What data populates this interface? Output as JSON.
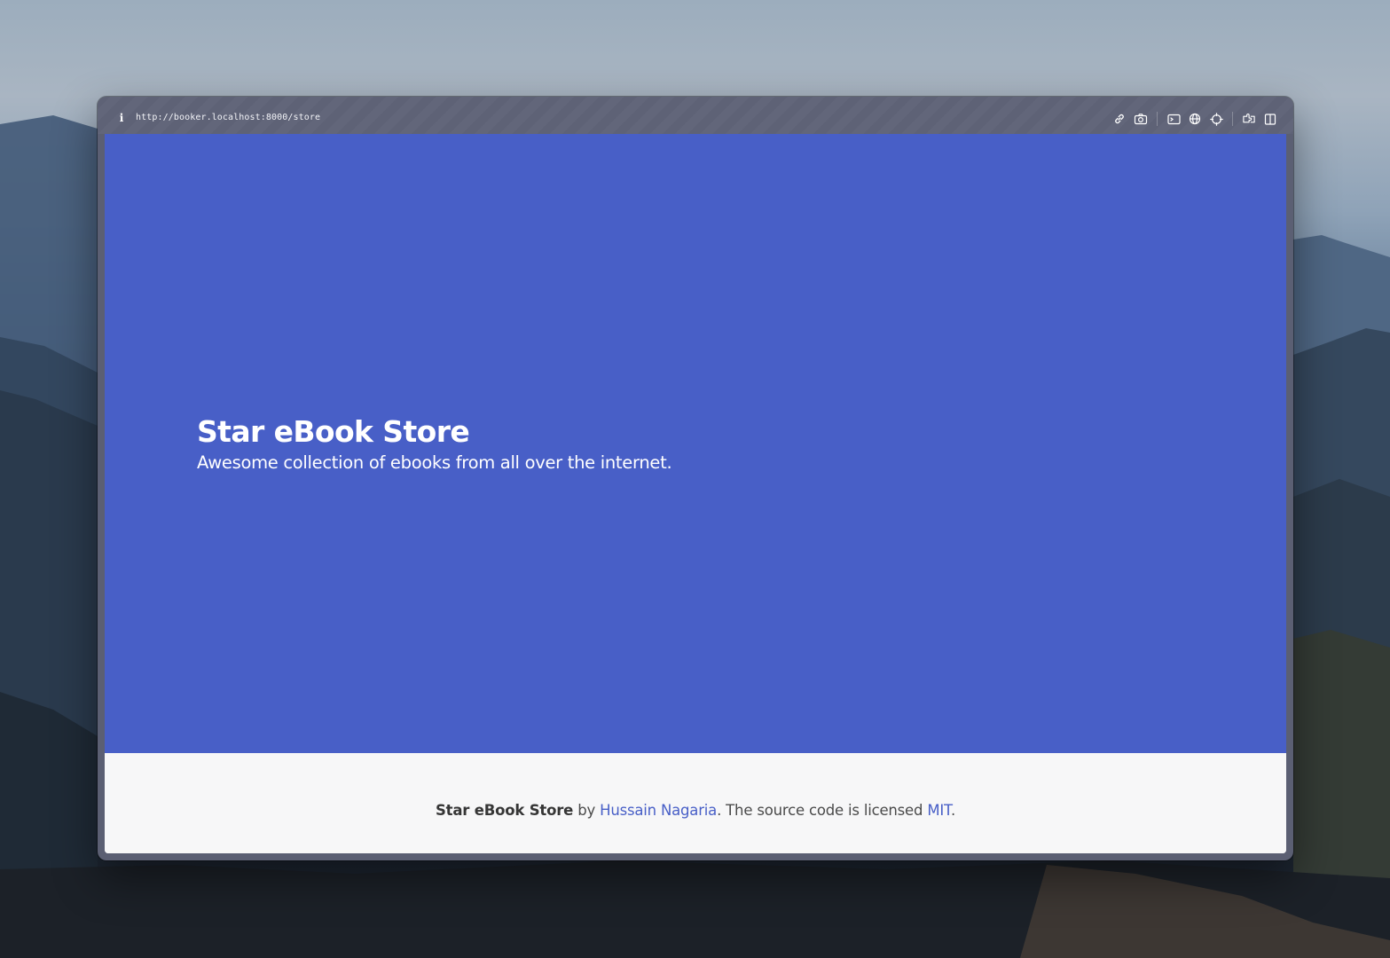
{
  "browser": {
    "url": "http://booker.localhost:8000/store",
    "toolbar_icons": [
      "link-icon",
      "camera-icon",
      "terminal-icon",
      "globe-icon",
      "crosshair-icon",
      "extensions-icon",
      "split-view-icon"
    ]
  },
  "hero": {
    "title": "Star eBook Store",
    "subtitle": "Awesome collection of ebooks from all over the internet.",
    "background_color": "#485fc7"
  },
  "footer": {
    "brand": "Star eBook Store",
    "by_text": " by ",
    "author_link": "Hussain Nagaria",
    "license_text": ". The source code is licensed ",
    "license_link": "MIT",
    "end_text": ".",
    "link_color": "#485fc7"
  }
}
